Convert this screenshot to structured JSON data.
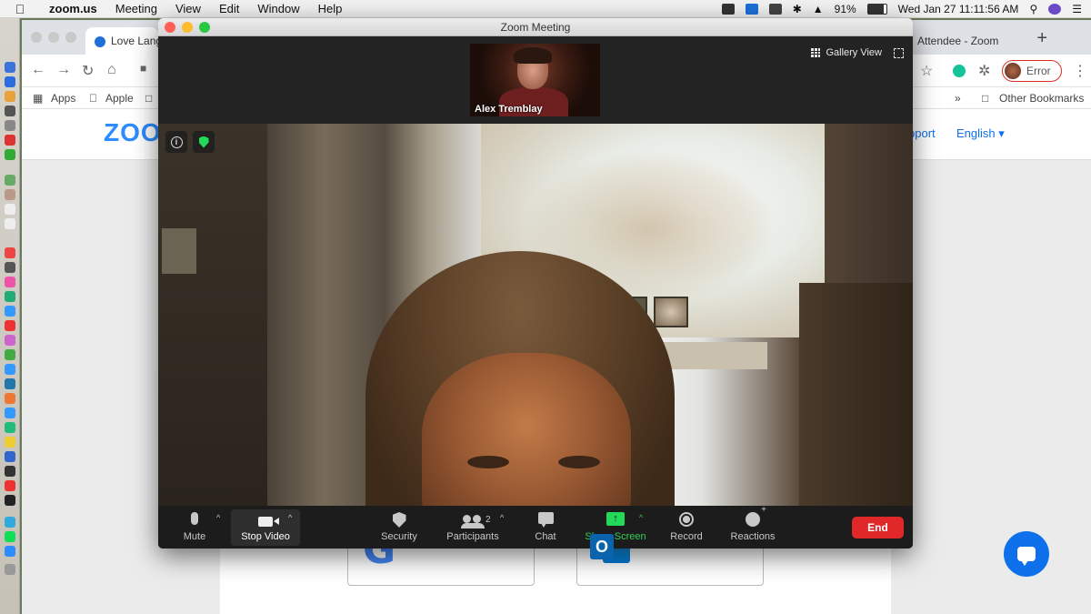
{
  "menubar": {
    "app": "zoom.us",
    "items": [
      "Meeting",
      "View",
      "Edit",
      "Window",
      "Help"
    ],
    "battery": "91%",
    "clock": "Wed Jan 27  11:11:56 AM"
  },
  "chrome": {
    "tabs": [
      "Love Lang",
      "Attendee - Zoom"
    ],
    "bookmarks": [
      "Apps",
      "Apple"
    ],
    "other_bookmarks": "Other Bookmarks",
    "profile_status": "Error",
    "overflow": "»"
  },
  "zoom_site": {
    "logo": "ZOO",
    "support": "pport",
    "language": "English"
  },
  "meeting": {
    "window_title": "Zoom Meeting",
    "gallery_view": "Gallery View",
    "participant_name": "Alex Tremblay",
    "info_symbol": "i",
    "controls": {
      "mute": "Mute",
      "stop_video": "Stop Video",
      "security": "Security",
      "participants": "Participants",
      "participants_count": "2",
      "chat": "Chat",
      "share_screen": "Share Screen",
      "record": "Record",
      "reactions": "Reactions",
      "end": "End"
    },
    "caret": "^",
    "share_symbol": "↑"
  },
  "colors": {
    "zoom_blue": "#2d8cff",
    "end_red": "#e02828",
    "share_green": "#23d959"
  }
}
